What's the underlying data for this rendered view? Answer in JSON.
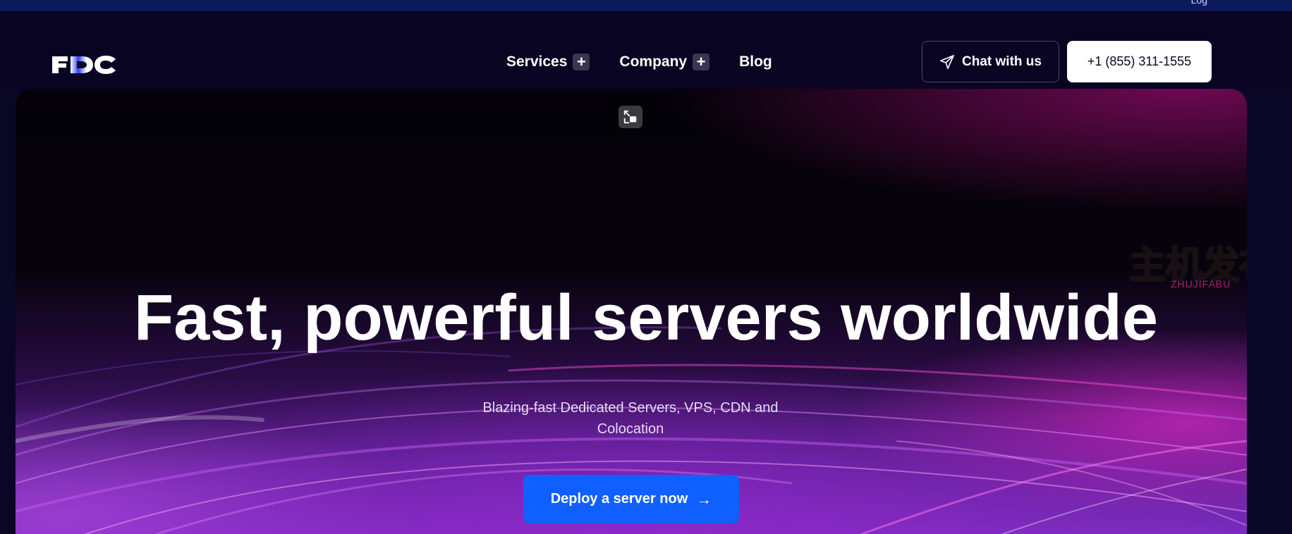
{
  "topstrip": {
    "partial_text": "Log"
  },
  "brand": {
    "logo_text": "FDC"
  },
  "nav": {
    "items": [
      {
        "label": "Services",
        "has_submenu": true
      },
      {
        "label": "Company",
        "has_submenu": true
      },
      {
        "label": "Blog",
        "has_submenu": false
      }
    ],
    "submenu_glyph": "+"
  },
  "header_actions": {
    "chat_label": "Chat with us",
    "phone_label": "+1 (855) 311-1555"
  },
  "hero": {
    "headline": "Fast, powerful servers worldwide",
    "subheadline": "Blazing-fast Dedicated Servers, VPS, CDN and Colocation",
    "cta_label": "Deploy a server now",
    "cta_arrow": "→"
  },
  "watermark": {
    "cn": "主机发布",
    "en": "ZHUJIFABU"
  },
  "colors": {
    "page_bg": "#0a0625",
    "top_strip": "#0a1a5c",
    "cta_blue": "#1060ff",
    "phone_btn_bg": "#ffffff"
  },
  "icons": {
    "chat": "send-icon",
    "expand": "expand-icon",
    "plus": "plus-icon",
    "arrow": "arrow-right-icon"
  }
}
